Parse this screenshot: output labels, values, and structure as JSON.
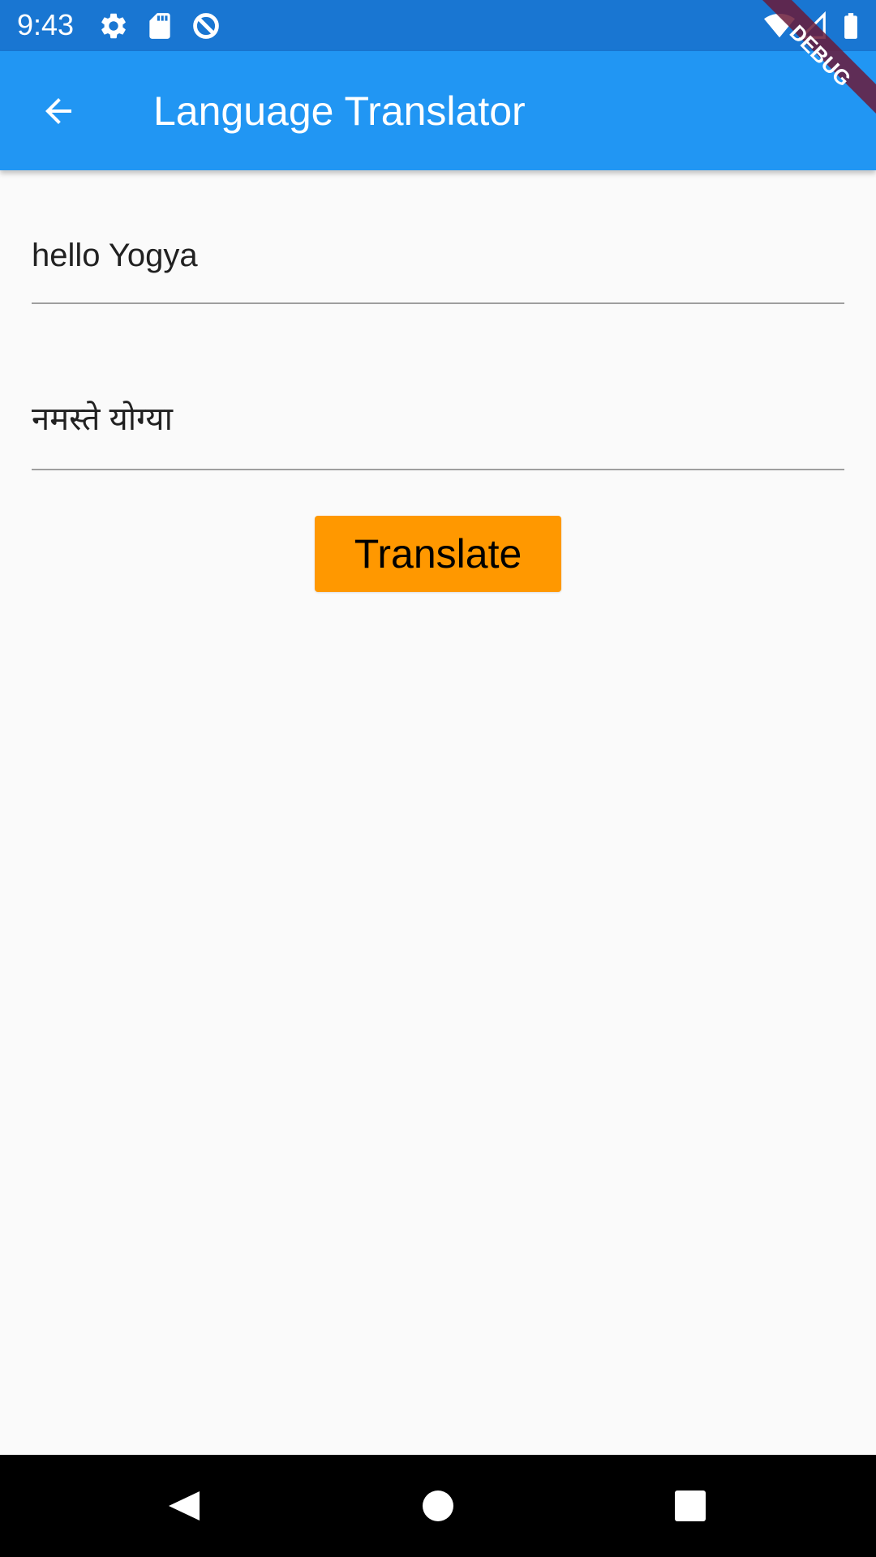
{
  "status_bar": {
    "time": "9:43",
    "icons": [
      "settings-icon",
      "sd-card-icon",
      "no-disturb-icon",
      "wifi-icon",
      "cell-signal-icon",
      "battery-icon"
    ],
    "background": "#1976d2"
  },
  "app_bar": {
    "title": "Language Translator",
    "back_icon": "arrow-back-icon",
    "background": "#2196f3"
  },
  "debug_banner": {
    "label": "DEBUG",
    "color": "#6a1b3a"
  },
  "form": {
    "source_text": "hello Yogya",
    "translated_text": "नमस्ते योग्या",
    "translate_label": "Translate",
    "button_color": "#ff9800"
  },
  "nav_bar": {
    "icons": [
      "back-triangle-icon",
      "home-circle-icon",
      "recents-square-icon"
    ]
  }
}
